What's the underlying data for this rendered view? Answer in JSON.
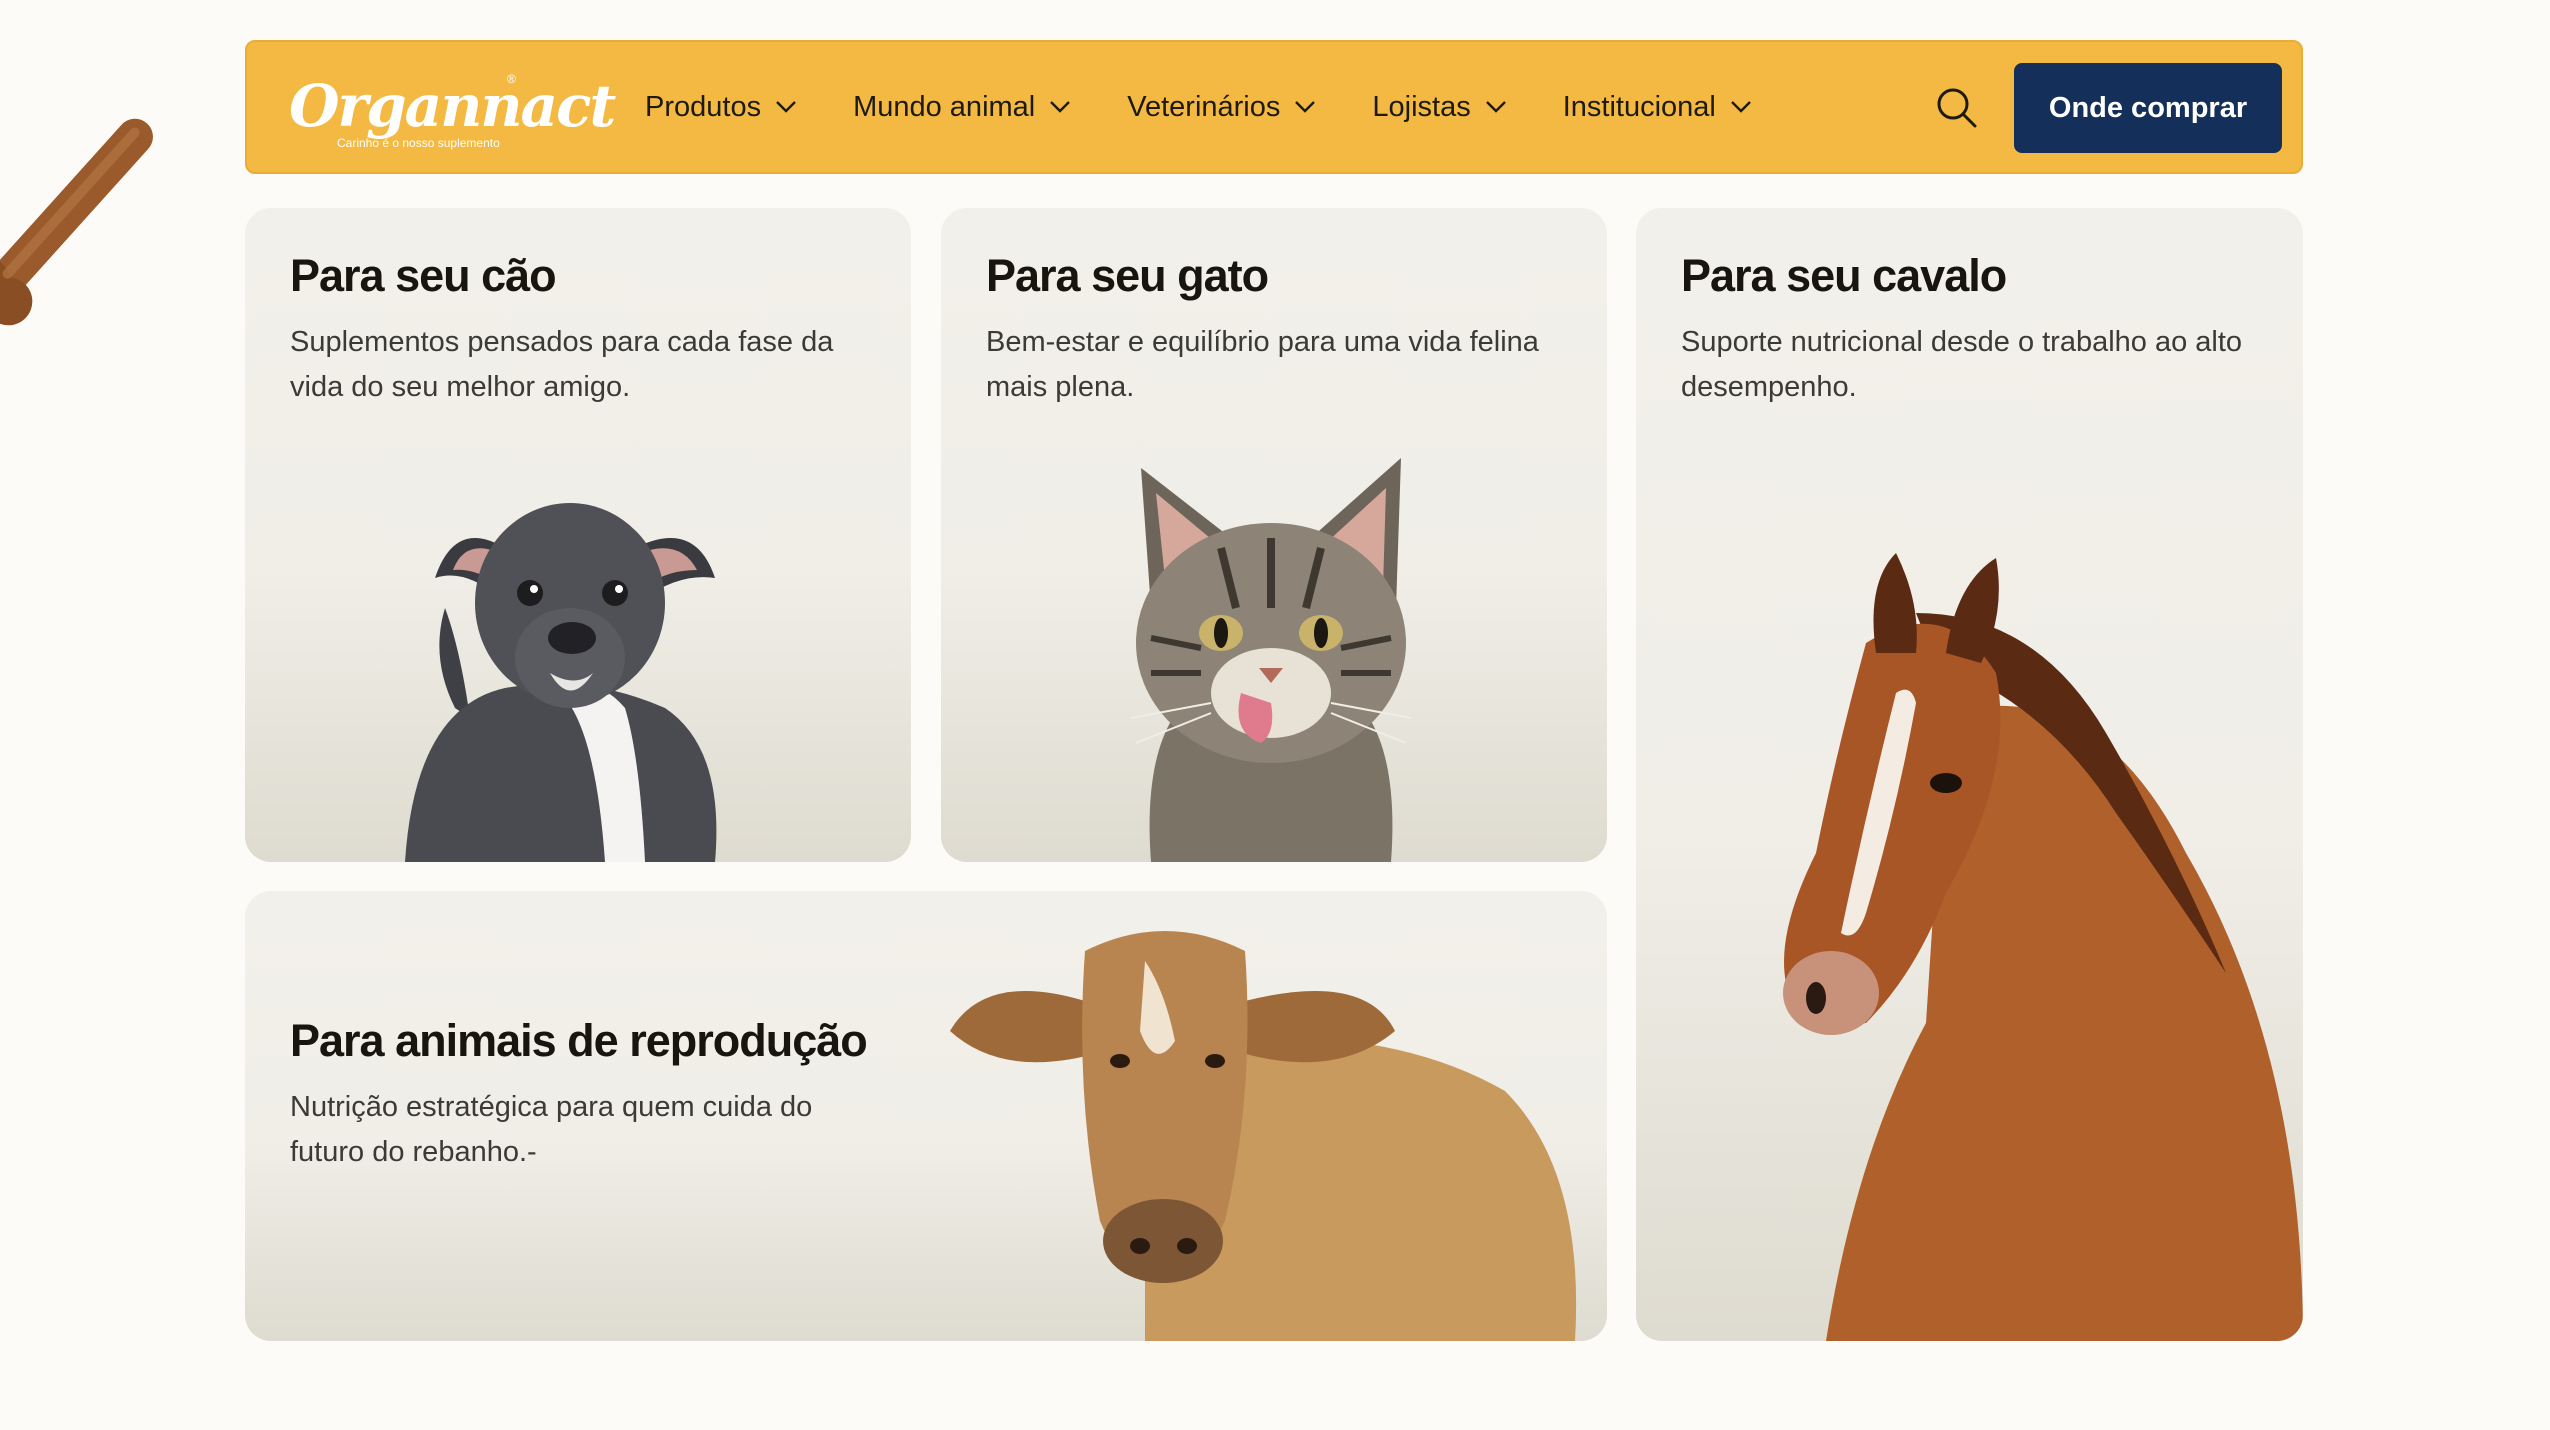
{
  "brand": {
    "name": "Organnact",
    "tagline": "Carinho é o nosso suplemento",
    "registered": "®"
  },
  "nav": {
    "items": [
      {
        "label": "Produtos"
      },
      {
        "label": "Mundo animal"
      },
      {
        "label": "Veterinários"
      },
      {
        "label": "Lojistas"
      },
      {
        "label": "Institucional"
      }
    ],
    "cta": "Onde comprar"
  },
  "cards": {
    "dog": {
      "title": "Para seu cão",
      "text": "Suplementos pensados para cada fase da vida do seu melhor amigo."
    },
    "cat": {
      "title": "Para seu gato",
      "text": "Bem-estar e equilíbrio para uma vida felina mais plena."
    },
    "horse": {
      "title": "Para seu cavalo",
      "text": "Suporte nutricional desde o trabalho ao alto desempenho."
    },
    "cow": {
      "title": "Para animais de reprodução",
      "text": "Nutrição estratégica para quem cuida do futuro do rebanho.-"
    }
  },
  "colors": {
    "header": "#f4b942",
    "cta": "#132f5a",
    "card": "#f2f0ea",
    "page": "#fcfbf7"
  },
  "icons": [
    "bone-icon",
    "search-icon",
    "chevron-down-icon",
    "dog-image",
    "cat-image",
    "horse-image",
    "cow-image"
  ]
}
